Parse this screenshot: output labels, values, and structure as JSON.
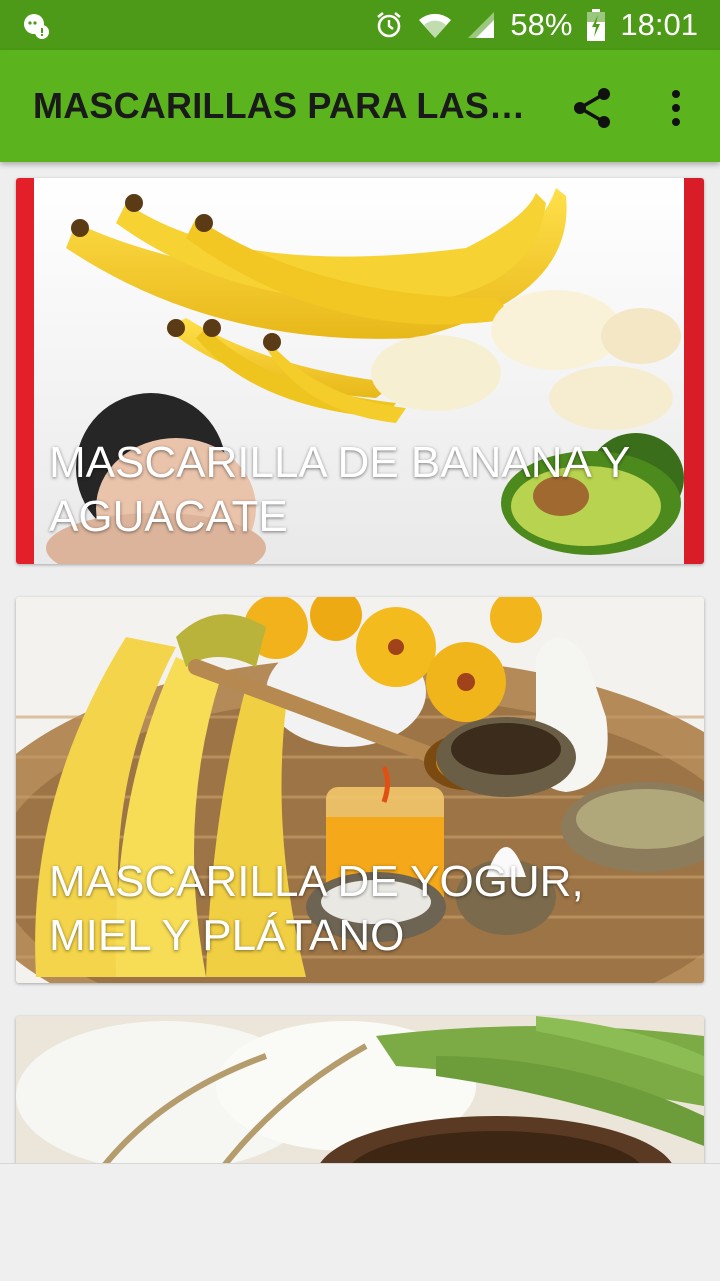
{
  "status_bar": {
    "battery_percent": "58%",
    "time": "18:01",
    "icons": [
      "chat-notification-icon",
      "alarm-icon",
      "wifi-icon",
      "signal-icon",
      "battery-charging-icon"
    ]
  },
  "app_bar": {
    "title": "MASCARILLAS PARA LAS…",
    "actions": [
      "share-icon",
      "more-vert-icon"
    ],
    "color": "#5bb31e"
  },
  "cards": [
    {
      "caption": "MASCARILLA DE BANANA Y AGUACATE"
    },
    {
      "caption": "MASCARILLA DE YOGUR, MIEL Y PLÁTANO"
    },
    {
      "caption": ""
    }
  ],
  "colors": {
    "status_bar": "#4c9a17",
    "app_bar": "#5bb31e",
    "background": "#eeeeee",
    "card1_border": "#e3202a"
  }
}
